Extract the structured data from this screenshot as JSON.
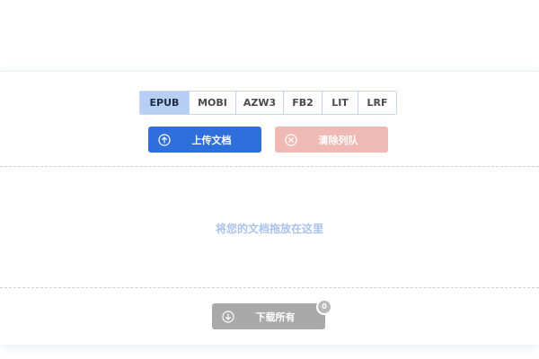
{
  "formats": {
    "items": [
      {
        "label": "EPUB",
        "active": true
      },
      {
        "label": "MOBI",
        "active": false
      },
      {
        "label": "AZW3",
        "active": false
      },
      {
        "label": "FB2",
        "active": false
      },
      {
        "label": "LIT",
        "active": false
      },
      {
        "label": "LRF",
        "active": false
      }
    ]
  },
  "actions": {
    "upload_label": "上传文档",
    "upload_icon": "arrow-up-circle-icon",
    "clear_label": "清除列队",
    "clear_icon": "x-circle-icon"
  },
  "dropzone": {
    "text": "将您的文档拖放在这里"
  },
  "download": {
    "label": "下载所有",
    "icon": "arrow-down-circle-icon",
    "count": "0"
  },
  "colors": {
    "primary": "#2f6fdc",
    "danger_disabled": "#efb9b5",
    "disabled": "#a9a9a9",
    "active_tab": "#b7cff3",
    "hint_text": "#a9c2ef"
  }
}
